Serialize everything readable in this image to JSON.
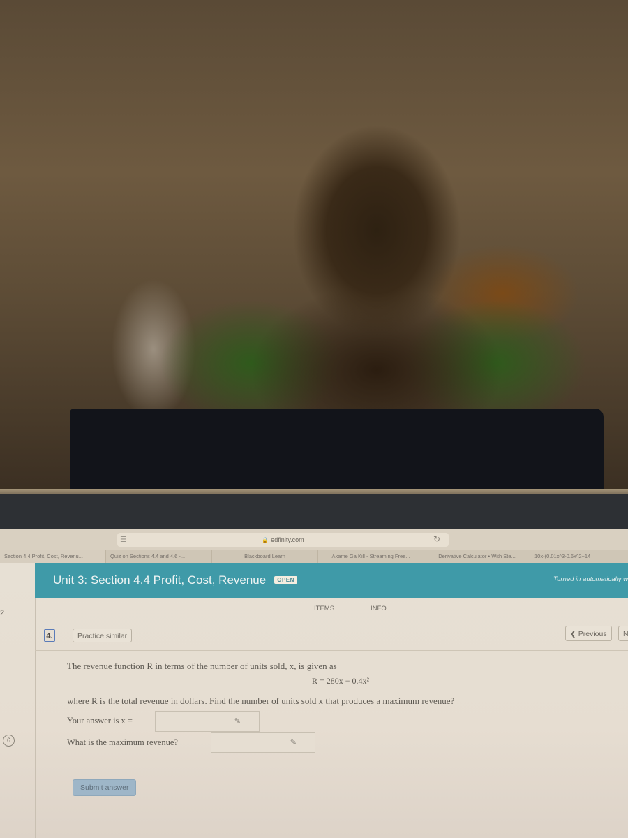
{
  "photo": {
    "description": "Photograph of laptop screen; upper portion shows reflection on bezel"
  },
  "browser": {
    "address_bar": {
      "domain": "edfinity.com",
      "lock_icon": "lock-icon",
      "menu_icon": "hamburger-icon",
      "reload_icon": "reload-icon"
    },
    "tabs": [
      {
        "label": "Section 4.4 Profit, Cost, Revenu...",
        "active": true
      },
      {
        "label": "Quiz on Sections 4.4 and 4.6 -...",
        "active": false
      },
      {
        "label": "Blackboard Learn",
        "active": false
      },
      {
        "label": "Akame Ga Kill - Streaming Free...",
        "active": false
      },
      {
        "label": "Derivative Calculator • With Ste...",
        "active": false
      },
      {
        "label": "10x-(0.01x^3-0.6x^2+14",
        "active": false
      }
    ]
  },
  "sidebar": {
    "numbers": [
      "2",
      "6"
    ]
  },
  "header": {
    "title": "Unit 3: Section 4.4 Profit, Cost, Revenue",
    "status_badge": "OPEN",
    "turned_in_note": "Turned in automatically w",
    "accent_color": "#3f9aa8"
  },
  "nav": {
    "tabs": [
      "ITEMS",
      "INFO"
    ]
  },
  "item": {
    "number": "4.",
    "practice_label": "Practice similar",
    "previous_label": "Previous",
    "next_label": "N"
  },
  "problem": {
    "intro": "The revenue function R in terms of the number of units sold, x, is given as",
    "formula": "R = 280x − 0.4x²",
    "question": "where R is the total revenue in dollars. Find the number of units sold x that produces a maximum revenue?",
    "answer1_label": "Your answer is x =",
    "answer1_value": "",
    "answer2_label": "What is the maximum revenue?",
    "answer2_value": "",
    "submit_label": "Submit answer"
  }
}
